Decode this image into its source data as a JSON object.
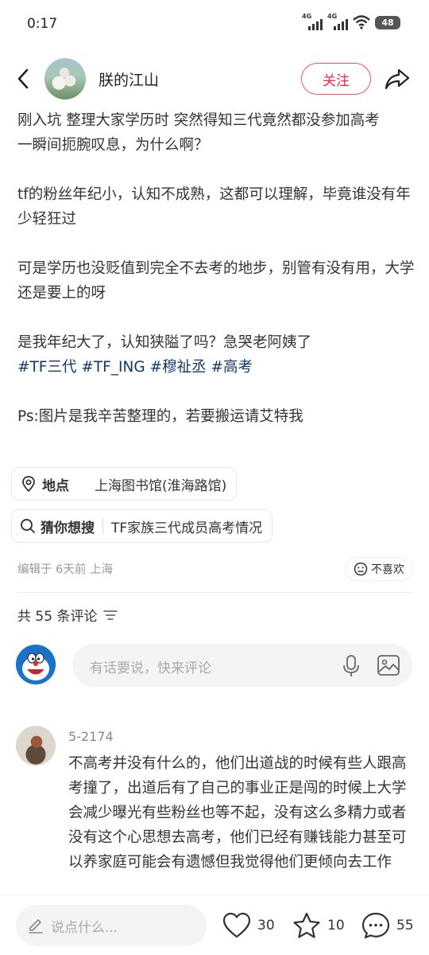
{
  "status_bar": {
    "time": "0:17",
    "signal_1": "4G",
    "signal_2": "4G",
    "battery": "48"
  },
  "header": {
    "author": "朕的江山",
    "follow_label": "关注",
    "icons": [
      "back-arrow-icon",
      "share-icon"
    ]
  },
  "post": {
    "paragraphs": [
      "刚入坑 整理大家学历时 突然得知三代竟然都没参加高考",
      "一瞬间扼腕叹息，为什么啊？",
      "",
      "tf的粉丝年纪小，认知不成熟，这都可以理解，毕竟谁没有年少轻狂过",
      "",
      "可是学历也没贬值到完全不去考的地步，别管有没有用，大学还是要上的呀",
      "",
      "是我年纪大了，认知狭隘了吗？急哭老阿姨了"
    ],
    "tags": [
      "#TF三代",
      "#TF_ING",
      "#穆祉丞",
      "#高考"
    ],
    "ps": "Ps:图片是我辛苦整理的，若要搬运请艾特我"
  },
  "location": {
    "label": "地点",
    "value": "上海图书馆(淮海路馆)"
  },
  "guess_search": {
    "label": "猜你想搜",
    "value": "TF家族三代成员高考情况"
  },
  "meta": {
    "edited": "编辑于 6天前 上海",
    "dislike_label": "不喜欢"
  },
  "comments": {
    "header": "共 55 条评论",
    "input_placeholder": "有话要说，快来评论",
    "items": [
      {
        "user": "5-2174",
        "text": "不高考并没有什么的，他们出道战的时候有些人跟高考撞了，出道后有了自己的事业正是闯的时候上大学会减少曝光有些粉丝也等不起，没有这么多精力或者没有这个心思想去高考，他们已经有赚钱能力甚至可以养家庭可能会有遗憾但我觉得他们更倾向去工作"
      }
    ]
  },
  "bottom_bar": {
    "input_placeholder": "说点什么...",
    "likes": "30",
    "stars": "10",
    "comments": "55"
  },
  "colors": {
    "accent_red": "#ff2442",
    "tag_blue": "#13386c"
  }
}
